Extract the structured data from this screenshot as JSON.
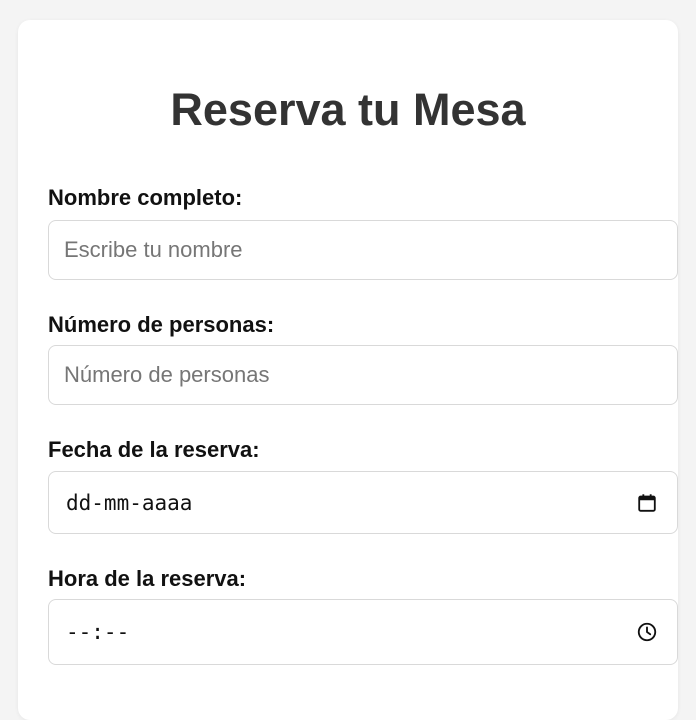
{
  "form": {
    "title": "Reserva tu Mesa",
    "name": {
      "label": "Nombre completo:",
      "placeholder": "Escribe tu nombre",
      "value": ""
    },
    "people": {
      "label": "Número de personas:",
      "placeholder": "Número de personas",
      "value": ""
    },
    "date": {
      "label": "Fecha de la reserva:",
      "display": "dd-mm-aaaa",
      "icon": "calendar-icon"
    },
    "time": {
      "label": "Hora de la reserva:",
      "display": "--:--",
      "icon": "clock-icon"
    }
  }
}
